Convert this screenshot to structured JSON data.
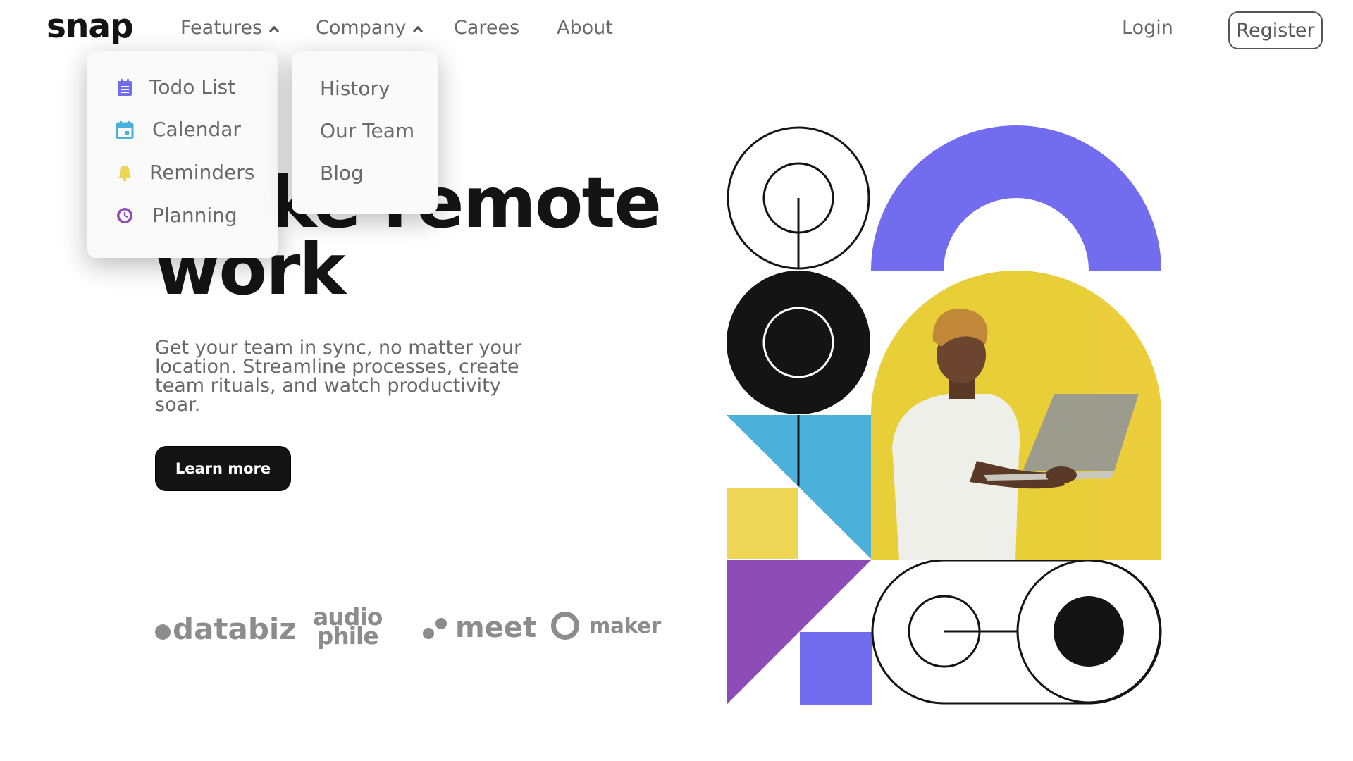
{
  "header": {
    "logo": "snap",
    "nav": {
      "features": "Features",
      "company": "Company",
      "careers": "Carees",
      "about": "About"
    },
    "login": "Login",
    "register": "Register"
  },
  "features_menu": [
    {
      "label": "Todo List",
      "icon": "todo-icon",
      "color": "#726CEE"
    },
    {
      "label": "Calendar",
      "icon": "calendar-icon",
      "color": "#4BB1DA"
    },
    {
      "label": "Reminders",
      "icon": "bell-icon",
      "color": "#EDD556"
    },
    {
      "label": "Planning",
      "icon": "clock-icon",
      "color": "#8E4CB6"
    }
  ],
  "company_menu": [
    "History",
    "Our Team",
    "Blog"
  ],
  "hero": {
    "headline_line1": "Make remote",
    "headline_line2": "work",
    "subtitle": "Get your team in sync, no matter your location. Streamline processes, create team rituals, and watch productivity soar.",
    "cta": "Learn more"
  },
  "clients": {
    "databiz": "databiz",
    "audiophile_top": "audio",
    "audiophile_bottom": "phile",
    "meet": "meet",
    "maker": "maker"
  },
  "colors": {
    "purple": "#726CEE",
    "yellow": "#EDD556",
    "blue": "#4BB1DA",
    "violet": "#8E4CB6",
    "dark": "#141414"
  }
}
